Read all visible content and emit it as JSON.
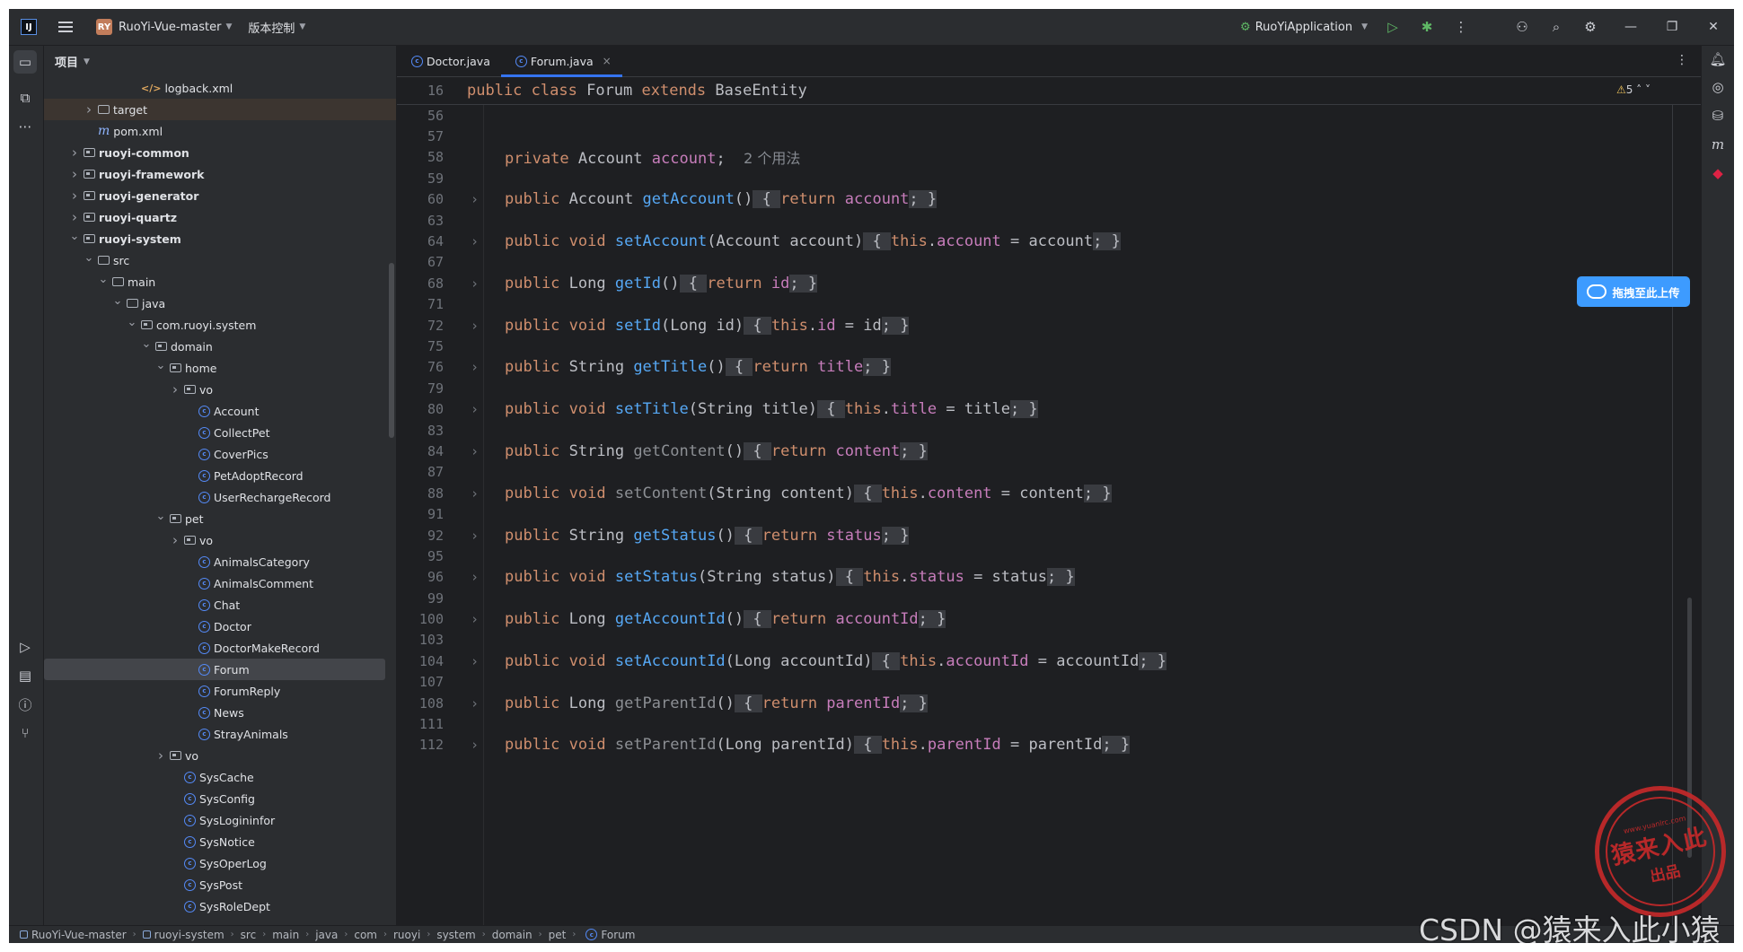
{
  "titlebar": {
    "project_badge": "RY",
    "project_name": "RuoYi-Vue-master",
    "vcs_label": "版本控制",
    "run_config": "RuoYiApplication"
  },
  "project_panel": {
    "title": "项目",
    "tree": [
      {
        "label": "logback.xml",
        "indent": 5,
        "icon": "xml"
      },
      {
        "label": "target",
        "indent": 2,
        "icon": "folder",
        "arrow": "right",
        "highlight": true
      },
      {
        "label": "pom.xml",
        "indent": 2,
        "icon": "maven"
      },
      {
        "label": "ruoyi-common",
        "indent": 1,
        "icon": "module",
        "arrow": "right",
        "bold": true
      },
      {
        "label": "ruoyi-framework",
        "indent": 1,
        "icon": "module",
        "arrow": "right",
        "bold": true
      },
      {
        "label": "ruoyi-generator",
        "indent": 1,
        "icon": "module",
        "arrow": "right",
        "bold": true
      },
      {
        "label": "ruoyi-quartz",
        "indent": 1,
        "icon": "module",
        "arrow": "right",
        "bold": true
      },
      {
        "label": "ruoyi-system",
        "indent": 1,
        "icon": "module",
        "arrow": "down",
        "bold": true
      },
      {
        "label": "src",
        "indent": 2,
        "icon": "folder",
        "arrow": "down"
      },
      {
        "label": "main",
        "indent": 3,
        "icon": "folder",
        "arrow": "down"
      },
      {
        "label": "java",
        "indent": 4,
        "icon": "folder",
        "arrow": "down"
      },
      {
        "label": "com.ruoyi.system",
        "indent": 5,
        "icon": "package",
        "arrow": "down"
      },
      {
        "label": "domain",
        "indent": 6,
        "icon": "package",
        "arrow": "down"
      },
      {
        "label": "home",
        "indent": 7,
        "icon": "package",
        "arrow": "down"
      },
      {
        "label": "vo",
        "indent": 8,
        "icon": "package",
        "arrow": "right"
      },
      {
        "label": "Account",
        "indent": 9,
        "icon": "class"
      },
      {
        "label": "CollectPet",
        "indent": 9,
        "icon": "class"
      },
      {
        "label": "CoverPics",
        "indent": 9,
        "icon": "class"
      },
      {
        "label": "PetAdoptRecord",
        "indent": 9,
        "icon": "class"
      },
      {
        "label": "UserRechargeRecord",
        "indent": 9,
        "icon": "class"
      },
      {
        "label": "pet",
        "indent": 7,
        "icon": "package",
        "arrow": "down"
      },
      {
        "label": "vo",
        "indent": 8,
        "icon": "package",
        "arrow": "right"
      },
      {
        "label": "AnimalsCategory",
        "indent": 9,
        "icon": "class"
      },
      {
        "label": "AnimalsComment",
        "indent": 9,
        "icon": "class"
      },
      {
        "label": "Chat",
        "indent": 9,
        "icon": "class"
      },
      {
        "label": "Doctor",
        "indent": 9,
        "icon": "class"
      },
      {
        "label": "DoctorMakeRecord",
        "indent": 9,
        "icon": "class"
      },
      {
        "label": "Forum",
        "indent": 9,
        "icon": "class",
        "selected": true
      },
      {
        "label": "ForumReply",
        "indent": 9,
        "icon": "class"
      },
      {
        "label": "News",
        "indent": 9,
        "icon": "class"
      },
      {
        "label": "StrayAnimals",
        "indent": 9,
        "icon": "class"
      },
      {
        "label": "vo",
        "indent": 7,
        "icon": "package",
        "arrow": "right"
      },
      {
        "label": "SysCache",
        "indent": 8,
        "icon": "class"
      },
      {
        "label": "SysConfig",
        "indent": 8,
        "icon": "class"
      },
      {
        "label": "SysLogininfor",
        "indent": 8,
        "icon": "class"
      },
      {
        "label": "SysNotice",
        "indent": 8,
        "icon": "class"
      },
      {
        "label": "SysOperLog",
        "indent": 8,
        "icon": "class"
      },
      {
        "label": "SysPost",
        "indent": 8,
        "icon": "class"
      },
      {
        "label": "SysRoleDept",
        "indent": 8,
        "icon": "class"
      }
    ]
  },
  "editor": {
    "tabs": [
      {
        "label": "Doctor.java",
        "active": false
      },
      {
        "label": "Forum.java",
        "active": true
      }
    ],
    "sticky_line": {
      "num": "16",
      "tokens": [
        [
          "kw",
          "public "
        ],
        [
          "kw",
          "class "
        ],
        [
          "ty",
          "Forum "
        ],
        [
          "kw",
          "extends "
        ],
        [
          "ty",
          "BaseEntity"
        ]
      ]
    },
    "warnings_count": "5",
    "lines": [
      {
        "num": "56",
        "tokens": []
      },
      {
        "num": "57",
        "tokens": []
      },
      {
        "num": "58",
        "tokens": [
          [
            "kw",
            "private "
          ],
          [
            "ty",
            "Account "
          ],
          [
            "fd",
            "account"
          ],
          [
            "pl",
            ";  "
          ],
          [
            "hint",
            "2 个用法"
          ]
        ]
      },
      {
        "num": "59",
        "tokens": []
      },
      {
        "num": "60",
        "fold": true,
        "tokens": [
          [
            "kw",
            "public "
          ],
          [
            "ty",
            "Account "
          ],
          [
            "fn",
            "getAccount"
          ],
          [
            "pl",
            "()"
          ],
          [
            "br",
            " { "
          ],
          [
            "kw",
            "return "
          ],
          [
            "fd",
            "account"
          ],
          [
            "br",
            ";"
          ],
          [
            "br",
            " }"
          ]
        ]
      },
      {
        "num": "63",
        "tokens": []
      },
      {
        "num": "64",
        "fold": true,
        "tokens": [
          [
            "kw",
            "public "
          ],
          [
            "kw",
            "void "
          ],
          [
            "fn",
            "setAccount"
          ],
          [
            "pl",
            "(Account account)"
          ],
          [
            "br",
            " { "
          ],
          [
            "kw",
            "this"
          ],
          [
            "pl",
            "."
          ],
          [
            "fd",
            "account"
          ],
          [
            "pl",
            " = account"
          ],
          [
            "br",
            ";"
          ],
          [
            "br",
            " }"
          ]
        ]
      },
      {
        "num": "67",
        "tokens": []
      },
      {
        "num": "68",
        "fold": true,
        "tokens": [
          [
            "kw",
            "public "
          ],
          [
            "ty",
            "Long "
          ],
          [
            "fn",
            "getId"
          ],
          [
            "pl",
            "()"
          ],
          [
            "br",
            " { "
          ],
          [
            "kw",
            "return "
          ],
          [
            "fd",
            "id"
          ],
          [
            "br",
            ";"
          ],
          [
            "br",
            " }"
          ]
        ]
      },
      {
        "num": "71",
        "tokens": []
      },
      {
        "num": "72",
        "fold": true,
        "tokens": [
          [
            "kw",
            "public "
          ],
          [
            "kw",
            "void "
          ],
          [
            "fn",
            "setId"
          ],
          [
            "pl",
            "(Long id)"
          ],
          [
            "br",
            " { "
          ],
          [
            "kw",
            "this"
          ],
          [
            "pl",
            "."
          ],
          [
            "fd",
            "id"
          ],
          [
            "pl",
            " = id"
          ],
          [
            "br",
            ";"
          ],
          [
            "br",
            " }"
          ]
        ]
      },
      {
        "num": "75",
        "tokens": []
      },
      {
        "num": "76",
        "fold": true,
        "tokens": [
          [
            "kw",
            "public "
          ],
          [
            "ty",
            "String "
          ],
          [
            "fn",
            "getTitle"
          ],
          [
            "pl",
            "()"
          ],
          [
            "br",
            " { "
          ],
          [
            "kw",
            "return "
          ],
          [
            "fd",
            "title"
          ],
          [
            "br",
            ";"
          ],
          [
            "br",
            " }"
          ]
        ]
      },
      {
        "num": "79",
        "tokens": []
      },
      {
        "num": "80",
        "fold": true,
        "tokens": [
          [
            "kw",
            "public "
          ],
          [
            "kw",
            "void "
          ],
          [
            "fn",
            "setTitle"
          ],
          [
            "pl",
            "(String title)"
          ],
          [
            "br",
            " { "
          ],
          [
            "kw",
            "this"
          ],
          [
            "pl",
            "."
          ],
          [
            "fd",
            "title"
          ],
          [
            "pl",
            " = title"
          ],
          [
            "br",
            ";"
          ],
          [
            "br",
            " }"
          ]
        ]
      },
      {
        "num": "83",
        "tokens": []
      },
      {
        "num": "84",
        "fold": true,
        "tokens": [
          [
            "kw",
            "public "
          ],
          [
            "ty",
            "String "
          ],
          [
            "gr",
            "getContent"
          ],
          [
            "pl",
            "()"
          ],
          [
            "br",
            " { "
          ],
          [
            "kw",
            "return "
          ],
          [
            "fd",
            "content"
          ],
          [
            "br",
            ";"
          ],
          [
            "br",
            " }"
          ]
        ]
      },
      {
        "num": "87",
        "tokens": []
      },
      {
        "num": "88",
        "fold": true,
        "tokens": [
          [
            "kw",
            "public "
          ],
          [
            "kw",
            "void "
          ],
          [
            "gr",
            "setContent"
          ],
          [
            "pl",
            "(String content)"
          ],
          [
            "br",
            " { "
          ],
          [
            "kw",
            "this"
          ],
          [
            "pl",
            "."
          ],
          [
            "fd",
            "content"
          ],
          [
            "pl",
            " = content"
          ],
          [
            "br",
            ";"
          ],
          [
            "br",
            " }"
          ]
        ]
      },
      {
        "num": "91",
        "tokens": []
      },
      {
        "num": "92",
        "fold": true,
        "tokens": [
          [
            "kw",
            "public "
          ],
          [
            "ty",
            "String "
          ],
          [
            "fn",
            "getStatus"
          ],
          [
            "pl",
            "()"
          ],
          [
            "br",
            " { "
          ],
          [
            "kw",
            "return "
          ],
          [
            "fd",
            "status"
          ],
          [
            "br",
            ";"
          ],
          [
            "br",
            " }"
          ]
        ]
      },
      {
        "num": "95",
        "tokens": []
      },
      {
        "num": "96",
        "fold": true,
        "tokens": [
          [
            "kw",
            "public "
          ],
          [
            "kw",
            "void "
          ],
          [
            "fn",
            "setStatus"
          ],
          [
            "pl",
            "(String status)"
          ],
          [
            "br",
            " { "
          ],
          [
            "kw",
            "this"
          ],
          [
            "pl",
            "."
          ],
          [
            "fd",
            "status"
          ],
          [
            "pl",
            " = status"
          ],
          [
            "br",
            ";"
          ],
          [
            "br",
            " }"
          ]
        ]
      },
      {
        "num": "99",
        "tokens": []
      },
      {
        "num": "100",
        "fold": true,
        "tokens": [
          [
            "kw",
            "public "
          ],
          [
            "ty",
            "Long "
          ],
          [
            "fn",
            "getAccountId"
          ],
          [
            "pl",
            "()"
          ],
          [
            "br",
            " { "
          ],
          [
            "kw",
            "return "
          ],
          [
            "fd",
            "accountId"
          ],
          [
            "br",
            ";"
          ],
          [
            "br",
            " }"
          ]
        ]
      },
      {
        "num": "103",
        "tokens": []
      },
      {
        "num": "104",
        "fold": true,
        "tokens": [
          [
            "kw",
            "public "
          ],
          [
            "kw",
            "void "
          ],
          [
            "fn",
            "setAccountId"
          ],
          [
            "pl",
            "(Long accountId)"
          ],
          [
            "br",
            " { "
          ],
          [
            "kw",
            "this"
          ],
          [
            "pl",
            "."
          ],
          [
            "fd",
            "accountId"
          ],
          [
            "pl",
            " = accountId"
          ],
          [
            "br",
            ";"
          ],
          [
            "br",
            " }"
          ]
        ]
      },
      {
        "num": "107",
        "tokens": []
      },
      {
        "num": "108",
        "fold": true,
        "tokens": [
          [
            "kw",
            "public "
          ],
          [
            "ty",
            "Long "
          ],
          [
            "gr",
            "getParentId"
          ],
          [
            "pl",
            "()"
          ],
          [
            "br",
            " { "
          ],
          [
            "kw",
            "return "
          ],
          [
            "fd",
            "parentId"
          ],
          [
            "br",
            ";"
          ],
          [
            "br",
            " }"
          ]
        ]
      },
      {
        "num": "111",
        "tokens": []
      },
      {
        "num": "112",
        "fold": true,
        "tokens": [
          [
            "kw",
            "public "
          ],
          [
            "kw",
            "void "
          ],
          [
            "gr",
            "setParentId"
          ],
          [
            "pl",
            "(Long parentId)"
          ],
          [
            "br",
            " { "
          ],
          [
            "kw",
            "this"
          ],
          [
            "pl",
            "."
          ],
          [
            "fd",
            "parentId"
          ],
          [
            "pl",
            " = parentId"
          ],
          [
            "br",
            ";"
          ],
          [
            "br",
            " }"
          ]
        ]
      }
    ],
    "upload_button": "拖拽至此上传"
  },
  "statusbar": {
    "breadcrumbs": [
      "RuoYi-Vue-master",
      "ruoyi-system",
      "src",
      "main",
      "java",
      "com",
      "ruoyi",
      "system",
      "domain",
      "pet",
      "Forum"
    ]
  },
  "watermark": {
    "stamp_main": "猿来入此",
    "stamp_sub": "出品",
    "stamp_url": "www.yuanlrc.com",
    "csdn_text": "CSDN @猿来入此小猿"
  },
  "colors": {
    "keyword": "#cf8e6d",
    "function": "#56a8f5",
    "field": "#c77dbb",
    "accent": "#3574f0",
    "stamp": "#c8292a"
  }
}
